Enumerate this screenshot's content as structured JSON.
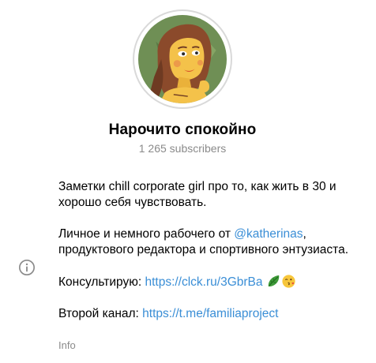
{
  "channel": {
    "name": "Нарочито спокойно",
    "subscribers": "1 265 subscribers"
  },
  "about": {
    "line1": "Заметки chill corporate girl про то, как жить в 30 и хорошо себя чувствовать.",
    "line2_prefix": "Личное и немного рабочего от ",
    "line2_link": "@katherinas",
    "line2_suffix": ", продуктового редактора и спортивного энтузиаста.",
    "line3_prefix": "Консультирую: ",
    "line3_link": "https://clck.ru/3GbrBa",
    "line3_emojis": [
      "leafy-green-emoji",
      "face-blowing-kiss-emoji"
    ],
    "line4_prefix": "Второй канал: ",
    "line4_link": "https://t.me/familiaproject",
    "label": "Info"
  },
  "colors": {
    "link": "#3a8ed6",
    "muted": "#8a8a8a",
    "avatar_bg": "#6f8f55",
    "avatar_skin": "#f4c24a",
    "avatar_hair": "#8b4a2b"
  },
  "icons": {
    "info": "info-circle-icon"
  }
}
